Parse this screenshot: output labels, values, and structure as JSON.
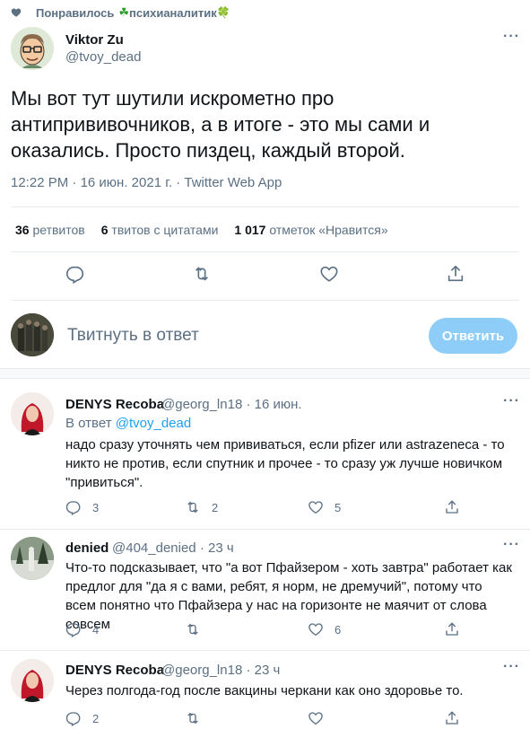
{
  "context": {
    "liked_by": "Понравилось",
    "liker_name": "психианалитик",
    "clover": "☘",
    "clover2": "🍀"
  },
  "tweet": {
    "author_name": "Viktor Zu",
    "author_handle": "@tvoy_dead",
    "text": "Мы вот тут шутили искрометно про антипрививочников, а в итоге - это мы сами и оказались. Просто пиздец, каждый второй.",
    "time": "12:22 PM",
    "date": "16 июн. 2021 г.",
    "client": "Twitter Web App",
    "retweets_count": "36",
    "retweets_label": "ретвитов",
    "quotes_count": "6",
    "quotes_label": "твитов с цитатами",
    "likes_count": "1 017",
    "likes_label": "отметок «Нравится»"
  },
  "reply_box": {
    "placeholder": "Твитнуть в ответ",
    "button": "Ответить"
  },
  "replies": [
    {
      "name": "DENYS Recoba",
      "handle": "@georg_ln18",
      "time": "16 июн.",
      "reply_to_label": "В ответ",
      "reply_to_handle": "@tvoy_dead",
      "text": "надо сразу уточнять чем прививаться, если pfizer или astrazeneca - то никто не против, если спутник и прочее - то сразу уж лучше новичком \"привиться\".",
      "replies": "3",
      "retweets": "2",
      "likes": "5"
    },
    {
      "name": "denied",
      "handle": "@404_denied",
      "time": "23 ч",
      "text": "Что-то подсказывает, что \"а вот Пфайзером - хоть завтра\" работает как предлог для \"да я с вами, ребят, я норм, не дремучий\", потому что всем понятно что Пфайзера у нас на горизонте не маячит от слова совсем",
      "replies": "4",
      "retweets": "",
      "likes": "6"
    },
    {
      "name": "DENYS Recoba",
      "handle": "@georg_ln18",
      "time": "23 ч",
      "text": "Через полгода-год после вакцины черкани как оно здоровье то.",
      "replies": "2",
      "retweets": "",
      "likes": ""
    }
  ],
  "separator": "·",
  "more_glyph": "···",
  "colors": {
    "accent": "#1da1f2",
    "muted": "#5b7083",
    "reply_button": "#8ecdf8",
    "border": "#e6ecf0"
  }
}
